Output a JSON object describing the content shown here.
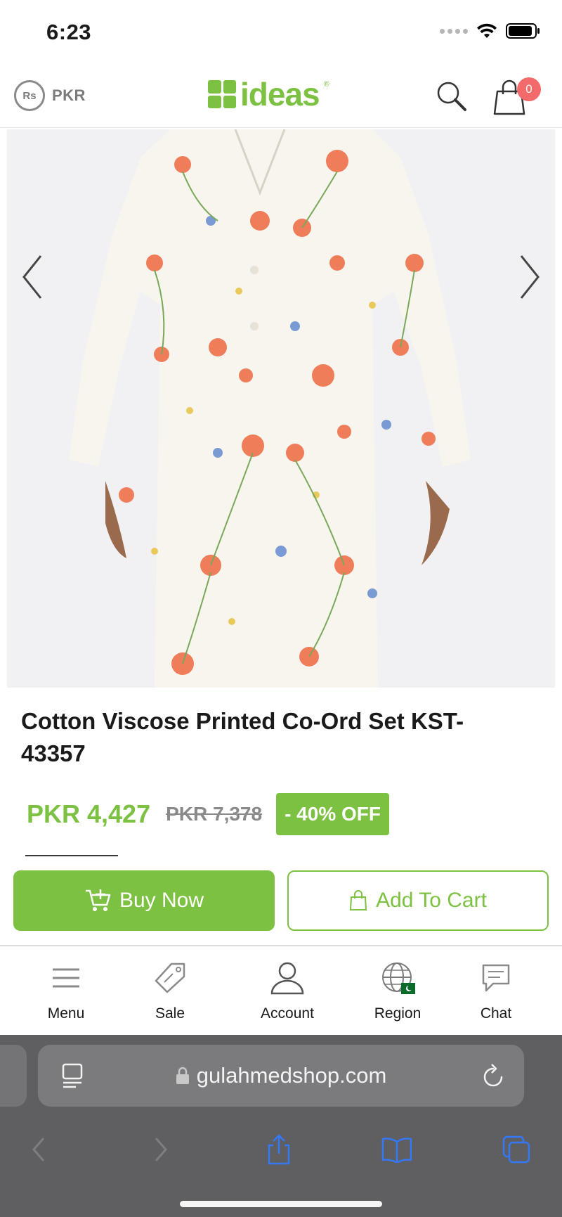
{
  "status_bar": {
    "time": "6:23"
  },
  "header": {
    "currency_symbol": "Rs",
    "currency_label": "PKR",
    "logo_text": "ideas",
    "logo_reg": "®",
    "cart_count": "0",
    "icons": {
      "search": "search-icon",
      "cart": "shopping-bag-icon"
    }
  },
  "gallery": {
    "image_description": "floral printed cotton kurta on model",
    "prev_icon": "chevron-left-icon",
    "next_icon": "chevron-right-icon"
  },
  "product": {
    "title": "Cotton Viscose Printed Co-Ord Set KST-43357",
    "price_current": "PKR 4,427",
    "price_old": "PKR 7,378",
    "discount": "- 40% OFF"
  },
  "actions": {
    "buy_now_label": "Buy Now",
    "add_to_cart_label": "Add To Cart"
  },
  "bottom_nav": {
    "items": [
      {
        "label": "Menu",
        "icon": "hamburger-icon"
      },
      {
        "label": "Sale",
        "icon": "tag-icon"
      },
      {
        "label": "Account",
        "icon": "user-icon"
      },
      {
        "label": "Region",
        "icon": "globe-icon"
      },
      {
        "label": "Chat",
        "icon": "chat-icon"
      }
    ]
  },
  "browser": {
    "url": "gulahmedshop.com"
  },
  "colors": {
    "brand_green": "#7cc142",
    "badge_red": "#f26a6a",
    "browser_chrome": "#5f5f61",
    "toolbar_blue": "#3478f6"
  }
}
